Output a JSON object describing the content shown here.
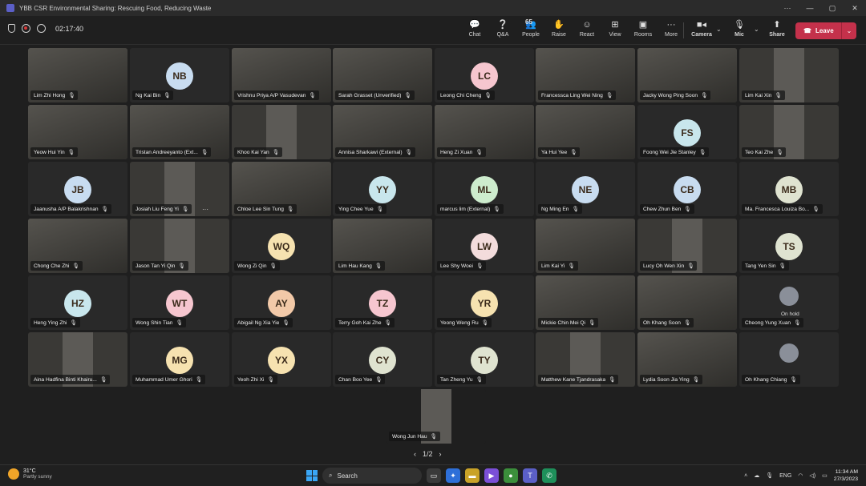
{
  "window": {
    "title": "YBB CSR Environmental Sharing: Rescuing Food, Reducing Waste",
    "controls": [
      "···",
      "—",
      "▢",
      "✕"
    ]
  },
  "toolbar": {
    "timer": "02:17:40",
    "buttons": [
      {
        "id": "chat",
        "label": "Chat",
        "icon": "chat-icon",
        "glyph": "💬"
      },
      {
        "id": "qa",
        "label": "Q&A",
        "icon": "qa-icon",
        "glyph": "❔"
      },
      {
        "id": "people",
        "label": "People",
        "icon": "people-icon",
        "glyph": "👥",
        "count": "65"
      },
      {
        "id": "raise",
        "label": "Raise",
        "icon": "hand-icon",
        "glyph": "✋"
      },
      {
        "id": "react",
        "label": "React",
        "icon": "smile-icon",
        "glyph": "☺"
      },
      {
        "id": "view",
        "label": "View",
        "icon": "grid-icon",
        "glyph": "⊞"
      },
      {
        "id": "rooms",
        "label": "Rooms",
        "icon": "rooms-icon",
        "glyph": "▣"
      },
      {
        "id": "more",
        "label": "More",
        "icon": "more-icon",
        "glyph": "···"
      }
    ],
    "camera_label": "Camera",
    "mic_label": "Mic",
    "share_label": "Share",
    "leave_label": "Leave"
  },
  "participants": [
    {
      "name": "Lim Zhi Hong",
      "video": true
    },
    {
      "name": "Ng Kai Bin",
      "initials": "NB",
      "color": "#c8dcf0"
    },
    {
      "name": "Vrishnu Priya A/P Vasudevan",
      "video": true
    },
    {
      "name": "Sarah Grasset (Unverified)",
      "video": true
    },
    {
      "name": "Leong Chi Cheng",
      "initials": "LC",
      "color": "#f6c6cf"
    },
    {
      "name": "Francessca Ling Wei Ning",
      "video": true
    },
    {
      "name": "Jacky Wong Ping Soon",
      "video": true
    },
    {
      "name": "Lim Kai Xin",
      "video": true,
      "narrow": true
    },
    {
      "name": "Yeow Hui Yin",
      "video": true
    },
    {
      "name": "Tristan Andreeyanto (Ext...",
      "video": true
    },
    {
      "name": "Khoo Kai Yan",
      "video": true,
      "narrow": true
    },
    {
      "name": "Annisa Sharkawi (External)",
      "video": true
    },
    {
      "name": "Heng Zi Xuan",
      "video": true
    },
    {
      "name": "Ya Hui Yee",
      "video": true
    },
    {
      "name": "Foong Wei Jie Stanley",
      "initials": "FS",
      "color": "#c8e6ec"
    },
    {
      "name": "Teo Kai Zhe",
      "video": true,
      "narrow": true
    },
    {
      "name": "Jaanusha A/P Balakrishnan",
      "initials": "JB",
      "color": "#c8dcf0"
    },
    {
      "name": "Josiah Liu Feng Yi",
      "video": true,
      "narrow": true,
      "more": true
    },
    {
      "name": "Chloe Lee Sin Tung",
      "video": true
    },
    {
      "name": "Ying Chee Yue",
      "initials": "YY",
      "color": "#c8e6ec"
    },
    {
      "name": "marcus lim (External)",
      "initials": "ML",
      "color": "#cdeccd"
    },
    {
      "name": "Ng Ming En",
      "initials": "NE",
      "color": "#c8dcf0"
    },
    {
      "name": "Chew Zhun Ben",
      "initials": "CB",
      "color": "#c8dcf0"
    },
    {
      "name": "Ma. Francesca Louiza Bo...",
      "initials": "MB",
      "color": "#dfe3d0"
    },
    {
      "name": "Chong Che Zhi",
      "video": true
    },
    {
      "name": "Jason Tan Yi Qin",
      "video": true,
      "narrow": true
    },
    {
      "name": "Wong Zi Qin",
      "initials": "WQ",
      "color": "#f6e2b0"
    },
    {
      "name": "Lim Hau Kang",
      "video": true
    },
    {
      "name": "Lee Shy Woei",
      "initials": "LW",
      "color": "#f3dcdc"
    },
    {
      "name": "Lim Kai Yi",
      "video": true
    },
    {
      "name": "Lucy Oh Wen Xin",
      "video": true,
      "narrow": true
    },
    {
      "name": "Tang Yen Sin",
      "initials": "TS",
      "color": "#dfe3d0"
    },
    {
      "name": "Heng Ying Zhi",
      "initials": "HZ",
      "color": "#c8e6ec"
    },
    {
      "name": "Wong Shin Tian",
      "initials": "WT",
      "color": "#f6c6cf"
    },
    {
      "name": "Abigail Ng Xia Yie",
      "initials": "AY",
      "color": "#f2c9a8"
    },
    {
      "name": "Terry Goh Kai Zhe",
      "initials": "TZ",
      "color": "#f6c6cf"
    },
    {
      "name": "Yeong Weng Ru",
      "initials": "YR",
      "color": "#f6e2b0"
    },
    {
      "name": "Mickie Chin Mei Qi",
      "video": true
    },
    {
      "name": "Oh Khang Soon",
      "video": true
    },
    {
      "name": "Cheong Yung Xuan",
      "video": false,
      "photo": true,
      "onhold": "On hold"
    },
    {
      "name": "Aina Hadfina Binti Khairu...",
      "video": true,
      "narrow": true
    },
    {
      "name": "Muhammad Umer Ghori",
      "initials": "MG",
      "color": "#f6e2b0"
    },
    {
      "name": "Yeoh Zhi Xi",
      "initials": "YX",
      "color": "#f6e2b0"
    },
    {
      "name": "Chan Boo Yee",
      "initials": "CY",
      "color": "#dfe3d0"
    },
    {
      "name": "Tan Zheng Yu",
      "initials": "TY",
      "color": "#dfe3d0"
    },
    {
      "name": "Matthew Kane Tjandrasaka",
      "video": true,
      "narrow": true
    },
    {
      "name": "Lydia Soon Jia Ying",
      "video": true
    },
    {
      "name": "Oh Khang Chiang",
      "video": false,
      "photo": true
    },
    {
      "name": "Wong Jun Hau",
      "video": true,
      "narrow": true
    }
  ],
  "pager": {
    "label": "1/2",
    "prev": "‹",
    "next": "›"
  },
  "taskbar": {
    "temp": "31°C",
    "condition": "Partly sunny",
    "search_label": "Search",
    "lang": "ENG",
    "time": "11:34 AM",
    "date": "27/3/2023"
  }
}
